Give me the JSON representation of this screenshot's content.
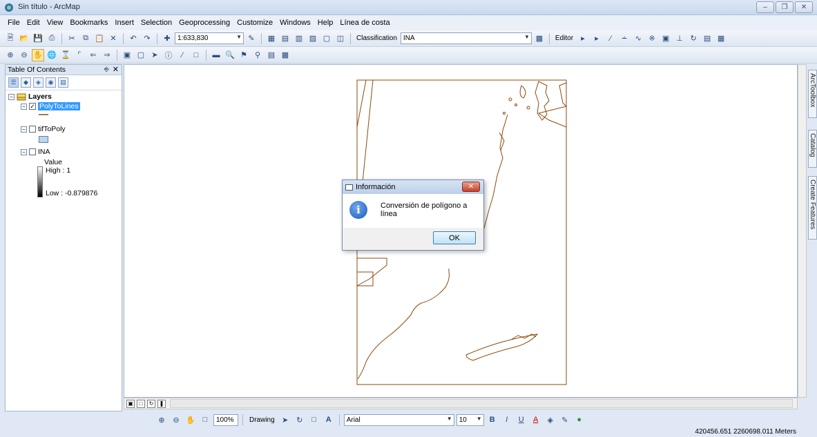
{
  "window": {
    "title": "Sin título - ArcMap"
  },
  "menu": [
    "File",
    "Edit",
    "View",
    "Bookmarks",
    "Insert",
    "Selection",
    "Geoprocessing",
    "Customize",
    "Windows",
    "Help",
    "Línea de costa"
  ],
  "toolbar": {
    "scale": "1:633,830",
    "classification_label": "Classification",
    "layer_combo": "INA",
    "editor_label": "Editor"
  },
  "toc": {
    "title": "Table Of Contents",
    "root": "Layers",
    "layers": [
      {
        "name": "PolyToLines",
        "checked": true
      },
      {
        "name": "tifToPoly",
        "checked": false
      },
      {
        "name": "INA",
        "checked": false
      }
    ],
    "legend": {
      "value_label": "Value",
      "high": "High : 1",
      "low": "Low : -0.879876"
    }
  },
  "side_tabs": [
    "ArcToolbox",
    "Catalog",
    "Create Features"
  ],
  "draw": {
    "drawing_label": "Drawing",
    "font": "Arial",
    "size": "10",
    "zoom": "100%"
  },
  "status": {
    "coords": "420456.651  2260698.011 Meters"
  },
  "dialog": {
    "title": "Información",
    "message": "Conversión de polígono a línea",
    "ok": "OK"
  },
  "colors": {
    "line": "#8b4a0c",
    "selection": "#3399ff"
  }
}
